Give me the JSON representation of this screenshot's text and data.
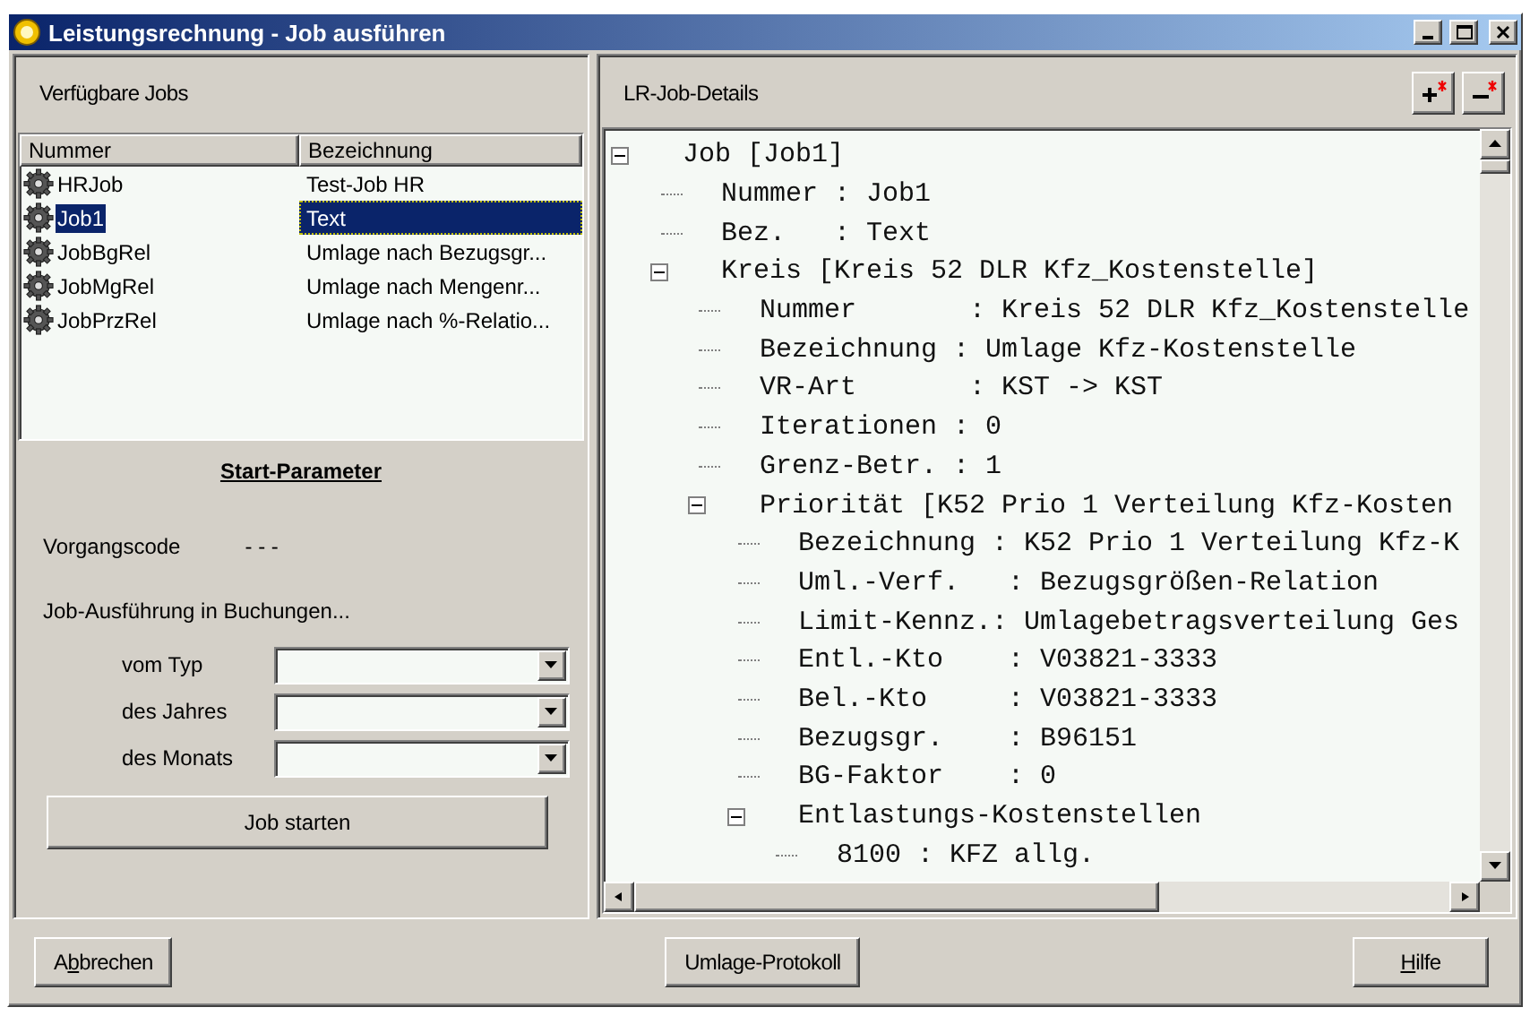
{
  "window": {
    "title": "Leistungsrechnung - Job ausführen"
  },
  "jobs_panel": {
    "title": "Verfügbare Jobs",
    "columns": [
      "Nummer",
      "Bezeichnung"
    ],
    "rows": [
      {
        "number": "HRJob",
        "description": "Test-Job HR",
        "selected": false
      },
      {
        "number": "Job1",
        "description": "Text",
        "selected": true
      },
      {
        "number": "JobBgRel",
        "description": "Umlage nach Bezugsgr...",
        "selected": false
      },
      {
        "number": "JobMgRel",
        "description": "Umlage nach Mengenr...",
        "selected": false
      },
      {
        "number": "JobPrzRel",
        "description": "Umlage nach %-Relatio...",
        "selected": false
      }
    ]
  },
  "start_parameters": {
    "title": "Start-Parameter",
    "process_code_label": "Vorgangscode",
    "process_code_value": "- - -",
    "bookings_label": "Job-Ausführung in Buchungen...",
    "fields": [
      {
        "label": "vom Typ"
      },
      {
        "label": "des Jahres"
      },
      {
        "label": "des Monats"
      }
    ],
    "start_button": "Job starten"
  },
  "details_panel": {
    "title": "LR-Job-Details",
    "tree": [
      {
        "text": "Job [Job1]",
        "expanded": true,
        "children": [
          {
            "text": "Nummer : Job1"
          },
          {
            "text": "Bez.   : Text"
          },
          {
            "text": "Kreis [Kreis 52 DLR Kfz_Kostenstelle]",
            "expanded": true,
            "children": [
              {
                "text": "Nummer       : Kreis 52 DLR Kfz_Kostenstelle"
              },
              {
                "text": "Bezeichnung : Umlage Kfz-Kostenstelle"
              },
              {
                "text": "VR-Art       : KST -> KST"
              },
              {
                "text": "Iterationen : 0"
              },
              {
                "text": "Grenz-Betr. : 1"
              },
              {
                "text": "Priorität [K52 Prio 1 Verteilung Kfz-Kosten",
                "expanded": true,
                "children": [
                  {
                    "text": "Bezeichnung : K52 Prio 1 Verteilung Kfz-K"
                  },
                  {
                    "text": "Uml.-Verf.   : Bezugsgrößen-Relation"
                  },
                  {
                    "text": "Limit-Kennz.: Umlagebetragsverteilung Ges"
                  },
                  {
                    "text": "Entl.-Kto    : V03821-3333"
                  },
                  {
                    "text": "Bel.-Kto     : V03821-3333"
                  },
                  {
                    "text": "Bezugsgr.    : B96151"
                  },
                  {
                    "text": "BG-Faktor    : 0"
                  },
                  {
                    "text": "Entlastungs-Kostenstellen",
                    "expanded": true,
                    "children": [
                      {
                        "text": "8100 : KFZ allg."
                      }
                    ]
                  }
                ]
              }
            ]
          }
        ]
      }
    ]
  },
  "footer_buttons": [
    {
      "before": "A",
      "key": "b",
      "after": "brechen"
    },
    {
      "before": "Umlage-Protokoll"
    },
    {
      "key": "H",
      "after": "ilfe"
    }
  ]
}
